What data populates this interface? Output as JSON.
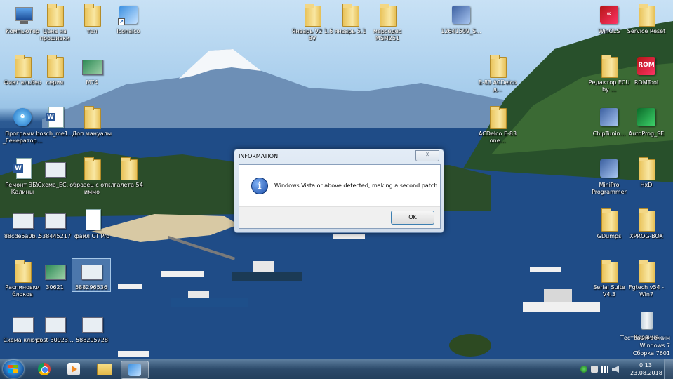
{
  "desktop": {
    "icons": [
      {
        "id": "computer",
        "label": "Компьютер",
        "kind": "computer"
      },
      {
        "id": "prices",
        "label": "Цена на прошивки",
        "kind": "folder"
      },
      {
        "id": "tel",
        "label": "тел",
        "kind": "folder"
      },
      {
        "id": "iconaico",
        "label": "Iconaico",
        "kind": "app"
      },
      {
        "id": "yanvar-v2",
        "label": "Январь V2 1.6 8V",
        "kind": "folder"
      },
      {
        "id": "yanvar-51",
        "label": "январь 5.1",
        "kind": "folder"
      },
      {
        "id": "mercedes",
        "label": "мерседес MSM251",
        "kind": "folder"
      },
      {
        "id": "chip-12641509",
        "label": "12641509_S...",
        "kind": "chip"
      },
      {
        "id": "winols",
        "label": "WinOLS",
        "kind": "app-red"
      },
      {
        "id": "service-reset",
        "label": "Service Reset",
        "kind": "folder"
      },
      {
        "id": "fiat-albea",
        "label": "Фиат альбео",
        "kind": "folder"
      },
      {
        "id": "seria",
        "label": "серия",
        "kind": "folder"
      },
      {
        "id": "m74",
        "label": "M74",
        "kind": "image-green"
      },
      {
        "id": "e83-acdelco",
        "label": "E-83 ACDelco д...",
        "kind": "folder"
      },
      {
        "id": "redaktor-ecu",
        "label": "Редактор ECU by ...",
        "kind": "folder"
      },
      {
        "id": "romtool",
        "label": "ROMTool",
        "kind": "app-red"
      },
      {
        "id": "programmator",
        "label": "Программ... _Генератор...",
        "kind": "ie"
      },
      {
        "id": "bosch",
        "label": "bosch_me1...",
        "kind": "doc"
      },
      {
        "id": "dop-manuals",
        "label": "Доп мануалы",
        "kind": "folder"
      },
      {
        "id": "acdelco-e83",
        "label": "ACDelco E-83 one...",
        "kind": "folder"
      },
      {
        "id": "chiptuning",
        "label": "ChipTunin...",
        "kind": "chip"
      },
      {
        "id": "autoprog",
        "label": "AutoProg_SE",
        "kind": "app-green"
      },
      {
        "id": "remont-ecu",
        "label": "Ремонт ЭБУ Калины",
        "kind": "doc"
      },
      {
        "id": "schema-ec",
        "label": "Схема_EC...",
        "kind": "image"
      },
      {
        "id": "obrazec",
        "label": "образец с откл иммо",
        "kind": "folder"
      },
      {
        "id": "galeta",
        "label": "галета 54",
        "kind": "folder"
      },
      {
        "id": "minipro",
        "label": "MiniPro Programmer",
        "kind": "chip"
      },
      {
        "id": "hxd",
        "label": "HxD",
        "kind": "folder"
      },
      {
        "id": "88cde",
        "label": "88cde5a0b...",
        "kind": "image"
      },
      {
        "id": "538445217",
        "label": "538445217",
        "kind": "image"
      },
      {
        "id": "file-ct-pro",
        "label": "файл CT Pro",
        "kind": "doc-plain"
      },
      {
        "id": "gdumps",
        "label": "GDumps",
        "kind": "folder"
      },
      {
        "id": "xprog-box",
        "label": "XPROG-BOX",
        "kind": "folder"
      },
      {
        "id": "raspinovki",
        "label": "Распиновки блоков",
        "kind": "folder"
      },
      {
        "id": "30621",
        "label": "30621",
        "kind": "image-green"
      },
      {
        "id": "588296536",
        "label": "588296536",
        "kind": "image",
        "selected": true
      },
      {
        "id": "serial-suite",
        "label": "Serial Suite V4.3",
        "kind": "folder"
      },
      {
        "id": "fgtech",
        "label": "Fgtech v54 - Win7",
        "kind": "folder"
      },
      {
        "id": "schema-klyucha",
        "label": "Схема ключа",
        "kind": "image"
      },
      {
        "id": "post-30923",
        "label": "post-30923...",
        "kind": "image"
      },
      {
        "id": "588295728",
        "label": "588295728",
        "kind": "image"
      },
      {
        "id": "recycle-bin",
        "label": "Корзина",
        "kind": "bin"
      }
    ],
    "watermark": {
      "line1": "Тестовый режим",
      "line2": "Windows 7",
      "line3": "Сборка 7601"
    }
  },
  "dialog": {
    "title": "INFORMATION",
    "close_glyph": "☓",
    "info_glyph": "i",
    "message": "Windows Vista or above detected, making a second patch",
    "ok_label": "OK"
  },
  "taskbar": {
    "clock_time": "0:13",
    "clock_date": "23.08.2018",
    "items": [
      "chrome",
      "media-player",
      "explorer",
      "iconaico"
    ],
    "active_item": "iconaico"
  }
}
